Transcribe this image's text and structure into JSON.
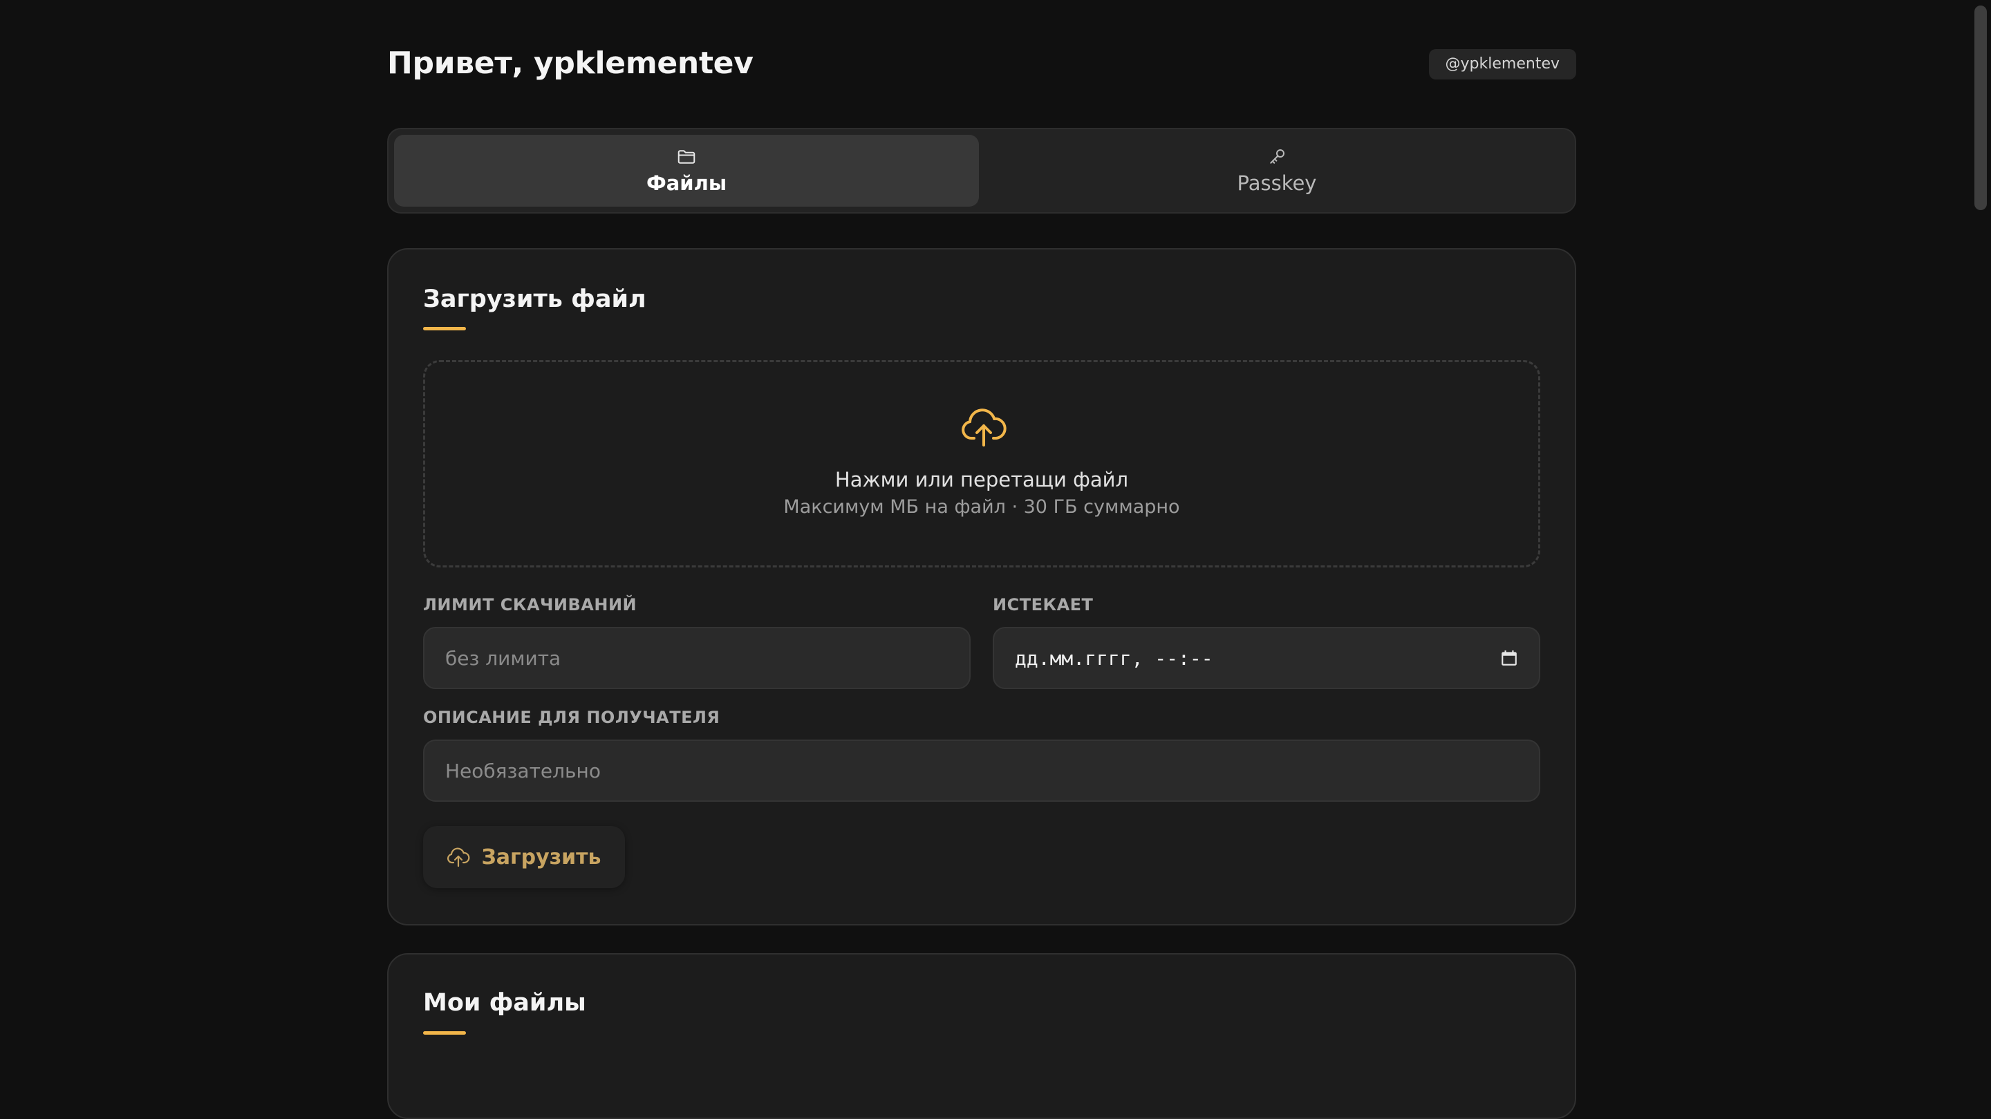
{
  "header": {
    "greeting": "Привет, ypklementev",
    "user_badge": "@ypklementev"
  },
  "tabs": [
    {
      "label": "Файлы",
      "icon": "folder-icon",
      "active": true
    },
    {
      "label": "Passkey",
      "icon": "key-icon",
      "active": false
    }
  ],
  "upload": {
    "title": "Загрузить файл",
    "dropzone_main": "Нажми или перетащи файл",
    "dropzone_sub": "Максимум МБ на файл · 30 ГБ суммарно",
    "limit_label": "ЛИМИТ СКАЧИВАНИЙ",
    "limit_placeholder": "без лимита",
    "expires_label": "ИСТЕКАЕТ",
    "expires_value": "дд.мм.гггг, --:--",
    "description_label": "ОПИСАНИЕ ДЛЯ ПОЛУЧАТЕЛЯ",
    "description_placeholder": "Необязательно",
    "button_label": "Загрузить"
  },
  "files": {
    "title": "Мои файлы"
  },
  "colors": {
    "accent": "#f2b64a",
    "background": "#101010",
    "card": "#1c1c1c",
    "button_text": "#c8a461"
  }
}
